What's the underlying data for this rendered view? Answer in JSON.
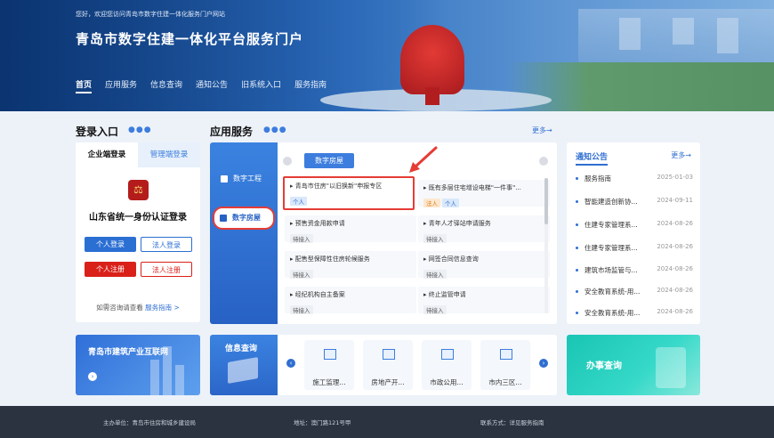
{
  "header": {
    "welcome": "您好，欢迎您访问青岛市数字住建一体化服务门户网站",
    "title": "青岛市数字住建一体化平台服务门户",
    "nav": [
      "首页",
      "应用服务",
      "信息查询",
      "通知公告",
      "旧系统入口",
      "服务指南"
    ]
  },
  "login": {
    "section_title": "登录入口",
    "tabs": [
      "企业端登录",
      "管理端登录"
    ],
    "emblem_glyph": "⚖",
    "title": "山东省统一身份认证登录",
    "btn_personal_login": "个人登录",
    "btn_corp_login": "法人登录",
    "btn_personal_register": "个人注册",
    "btn_corp_register": "法人注册",
    "help_prefix": "如需咨询请查看",
    "help_link": "服务指南 >"
  },
  "apps": {
    "section_title": "应用服务",
    "more": "更多→",
    "side": [
      "数字工程",
      "数字房屋"
    ],
    "sub_tab": "数字房屋",
    "cards": [
      {
        "title": "青岛市住房\"以旧换新\"申报专区",
        "tags": [
          [
            "个人",
            "blue"
          ]
        ]
      },
      {
        "title": "既有多层住宅增设电梯\"一件事\"...",
        "tags": [
          [
            "法人",
            "orange"
          ],
          [
            "个人",
            "blue"
          ]
        ]
      },
      {
        "title": "预售资金用款申请",
        "tags": [
          [
            "待接入",
            "gray"
          ]
        ]
      },
      {
        "title": "青年人才驿站申请服务",
        "tags": [
          [
            "待接入",
            "gray"
          ]
        ]
      },
      {
        "title": "配售型保障性住房轮候服务",
        "tags": [
          [
            "待接入",
            "gray"
          ]
        ]
      },
      {
        "title": "网签合同信息查询",
        "tags": [
          [
            "待接入",
            "gray"
          ]
        ]
      },
      {
        "title": "经纪机构自主备案",
        "tags": [
          [
            "待接入",
            "gray"
          ]
        ]
      },
      {
        "title": "终止监管申请",
        "tags": [
          [
            "待接入",
            "gray"
          ]
        ]
      }
    ]
  },
  "notice": {
    "title": "通知公告",
    "more": "更多→",
    "rows": [
      {
        "t": "服务指南",
        "d": "2025-01-03"
      },
      {
        "t": "智能建造创新协...",
        "d": "2024-09-11"
      },
      {
        "t": "住建专家管理系...",
        "d": "2024-08-26"
      },
      {
        "t": "住建专家管理系...",
        "d": "2024-08-26"
      },
      {
        "t": "建筑市场监管与...",
        "d": "2024-08-26"
      },
      {
        "t": "安全教育系统-用...",
        "d": "2024-08-26"
      },
      {
        "t": "安全教育系统-用...",
        "d": "2024-08-26"
      }
    ]
  },
  "bottom": {
    "banner1": "青岛市建筑产业互联网",
    "banner1_arrow": "›",
    "info_title": "信息查询",
    "prev": "‹",
    "next": "›",
    "tiles": [
      "施工监理...",
      "房地产开...",
      "市政公用...",
      "市内三区..."
    ],
    "banner2": "办事查询"
  },
  "footer": {
    "host": "主办单位：青岛市住房和城乡建设局",
    "address": "地址：澳门路121号甲",
    "contact": "联系方式：详见服务指南"
  },
  "colors": {
    "accent": "#2f6fd1",
    "highlight": "#e53c36"
  }
}
